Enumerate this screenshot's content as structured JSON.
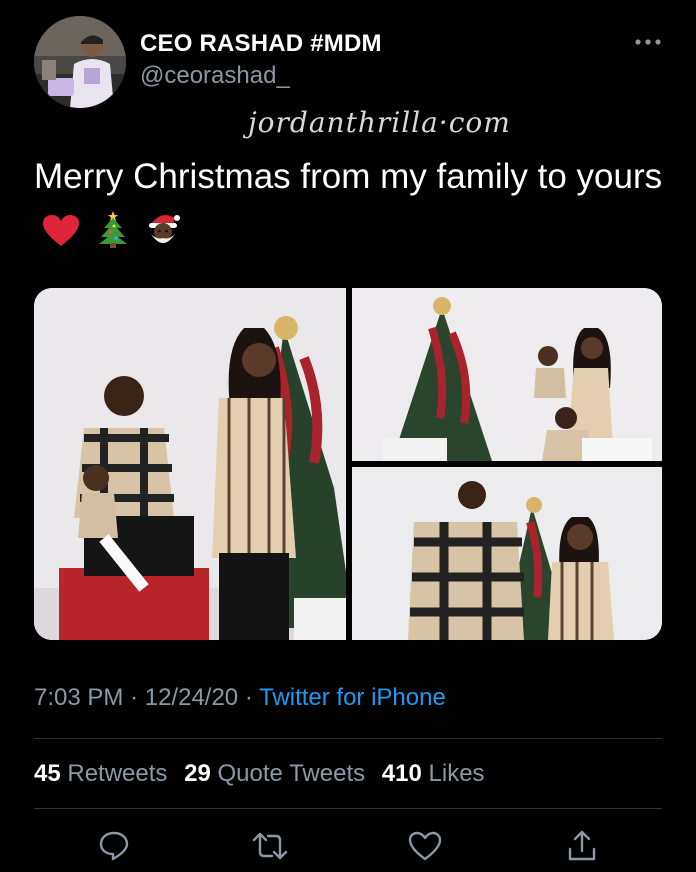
{
  "author": {
    "display_name": "CEO RASHAD #MDM",
    "handle": "@ceorashad_"
  },
  "watermark": "jordanthrilla·com",
  "tweet": {
    "text": "Merry Christmas from my family to yours",
    "emojis": [
      "red-heart-icon",
      "christmas-tree-icon",
      "santa-icon"
    ]
  },
  "meta": {
    "time": "7:03 PM",
    "separator": "·",
    "date": "12/24/20",
    "source": "Twitter for iPhone"
  },
  "stats": {
    "retweets_count": "45",
    "retweets_label": "Retweets",
    "quotes_count": "29",
    "quotes_label": "Quote Tweets",
    "likes_count": "410",
    "likes_label": "Likes"
  },
  "actions": [
    "reply-icon",
    "retweet-icon",
    "like-icon",
    "share-icon"
  ],
  "colors": {
    "background": "#000000",
    "text": "#ffffff",
    "muted": "#8b98a5",
    "link": "#1d9bf0",
    "divider": "#2f3336"
  }
}
